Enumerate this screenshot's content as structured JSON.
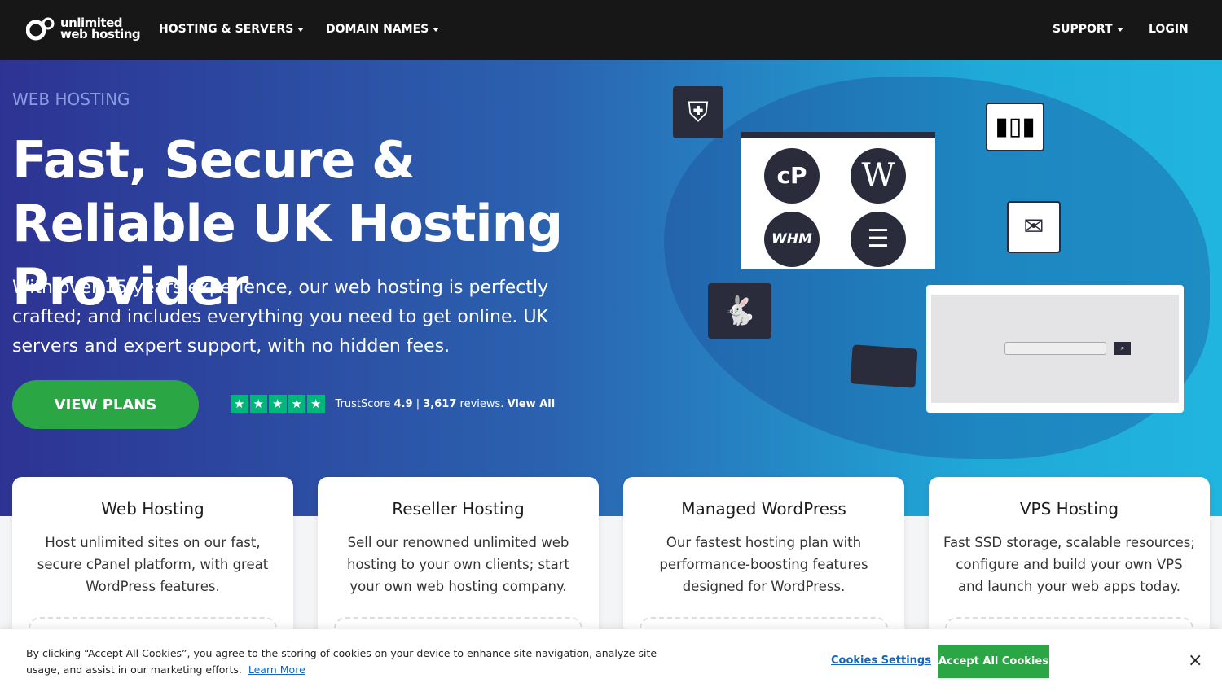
{
  "nav": {
    "logo_line1": "unlimited",
    "logo_line2": "web hosting",
    "items": [
      {
        "label": "HOSTING & SERVERS"
      },
      {
        "label": "DOMAIN NAMES"
      },
      {
        "label": "SUPPORT"
      }
    ],
    "login": "LOGIN"
  },
  "hero": {
    "eyebrow": "WEB HOSTING",
    "title": "Fast, Secure & Reliable UK Hosting Provider",
    "lead": "With over 15 years experience, our web hosting is perfectly crafted; and includes everything you need to get online. UK servers and expert support, with no hidden fees.",
    "cta": "VIEW PLANS",
    "trust": {
      "stars": 5,
      "label": "TrustScore",
      "score": "4.9",
      "sep": "|",
      "reviews": "3,617",
      "reviews_suffix": "reviews.",
      "view_all": "View All"
    },
    "illustration_labels": {
      "cpanel": "cP",
      "whm": "WHM"
    }
  },
  "cards": [
    {
      "title": "Web Hosting",
      "text": "Host unlimited sites on our fast, secure cPanel platform, with great WordPress features."
    },
    {
      "title": "Reseller Hosting",
      "text": "Sell our renowned unlimited web hosting to your own clients; start your own web hosting company."
    },
    {
      "title": "Managed WordPress",
      "text": "Our fastest hosting plan with performance-boosting features designed for WordPress."
    },
    {
      "title": "VPS Hosting",
      "text": "Fast SSD storage, scalable resources; configure and build your own VPS and launch your web apps today."
    }
  ],
  "cookie": {
    "message": "By clicking “Accept All Cookies”, you agree to the storing of cookies on your device to enhance site navigation, analyze site usage, and assist in our marketing efforts.",
    "learn_more": "Learn More",
    "settings": "Cookies Settings",
    "accept": "Accept All Cookies",
    "close": "×"
  },
  "colors": {
    "nav_bg": "#171717",
    "accent_green": "#2aa744",
    "trustpilot_green": "#00b67a",
    "link": "#1466c0"
  }
}
